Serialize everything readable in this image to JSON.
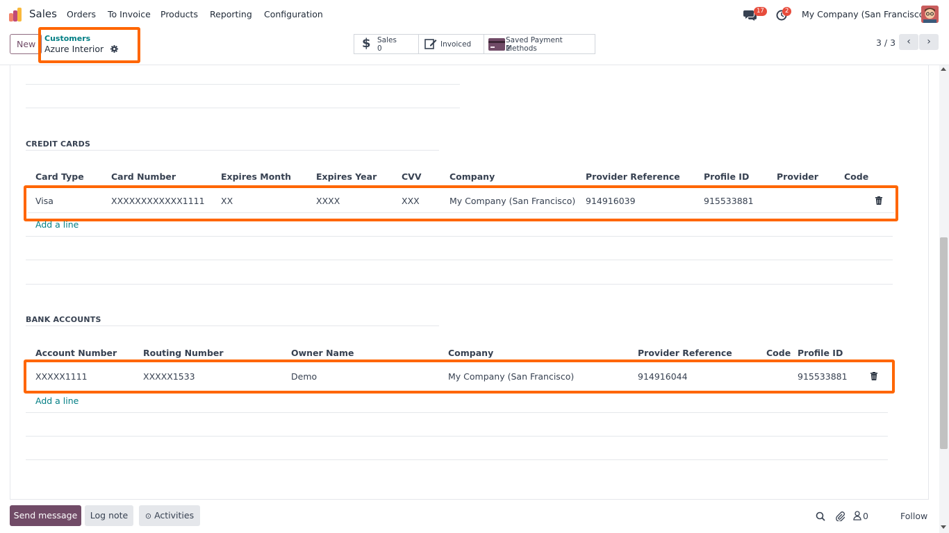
{
  "nav": {
    "app_name": "Sales",
    "menu": [
      "Orders",
      "To Invoice",
      "Products",
      "Reporting",
      "Configuration"
    ],
    "messages_count": "17",
    "activities_count": "2",
    "company": "My Company (San Francisco)"
  },
  "control": {
    "new_label": "New",
    "breadcrumb_parent": "Customers",
    "breadcrumb_current": "Azure Interior",
    "smart_buttons": {
      "sales_label": "Sales",
      "sales_value": "0",
      "invoiced_label": "Invoiced",
      "payment_label": "Saved Payment Methods",
      "payment_value": "2"
    },
    "pager": "3 / 3"
  },
  "credit_cards": {
    "title": "CREDIT CARDS",
    "columns": [
      "Card Type",
      "Card Number",
      "Expires Month",
      "Expires Year",
      "CVV",
      "Company",
      "Provider Reference",
      "Profile ID",
      "Provider",
      "Code"
    ],
    "row": [
      "Visa",
      "XXXXXXXXXXXX1111",
      "XX",
      "XXXX",
      "XXX",
      "My Company (San Francisco)",
      "914916039",
      "915533881",
      "",
      ""
    ],
    "add_line": "Add a line"
  },
  "bank_accounts": {
    "title": "BANK ACCOUNTS",
    "columns": [
      "Account Number",
      "Routing Number",
      "Owner Name",
      "Company",
      "Provider Reference",
      "Code",
      "Profile ID"
    ],
    "row": [
      "XXXXX1111",
      "XXXXX1533",
      "Demo",
      "My Company (San Francisco)",
      "914916044",
      "",
      "915533881"
    ],
    "add_line": "Add a line"
  },
  "chatter": {
    "send_message": "Send message",
    "log_note": "Log note",
    "activities": "Activities",
    "followers_count": "0",
    "follow": "Follow"
  },
  "colors": {
    "brand": "#714b67",
    "link": "#017e84",
    "highlight": "#ff6600",
    "badge": "#e74c3c"
  }
}
